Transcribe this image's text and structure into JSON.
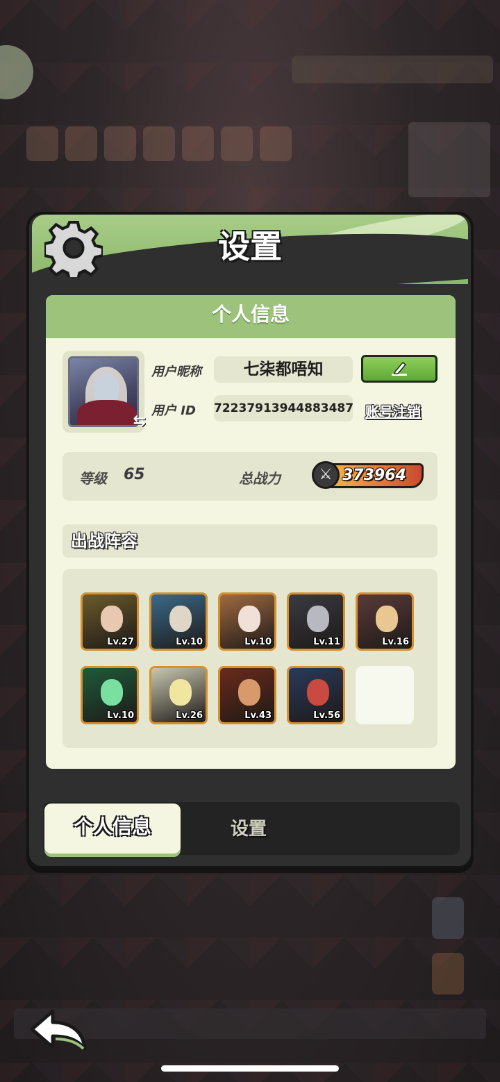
{
  "panel": {
    "title": "设置",
    "section_title": "个人信息"
  },
  "profile": {
    "nickname_label": "用户昵称",
    "nickname": "七柒都唔知",
    "id_label": "用户 ID",
    "user_id": "72237913944883487",
    "cancel_account_label": "账号注销",
    "swap_icon": "⇆"
  },
  "stats": {
    "level_label": "等级",
    "level": "65",
    "power_label": "总战力",
    "power": "373964"
  },
  "lineup": {
    "title": "出战阵容",
    "heroes": [
      {
        "lv": "Lv.27",
        "bg": "#6a5a2a",
        "skin": "#e8c8b0"
      },
      {
        "lv": "Lv.10",
        "bg": "#3a6a8a",
        "skin": "#e0d6c8"
      },
      {
        "lv": "Lv.10",
        "bg": "#a06a40",
        "skin": "#f0e0d8"
      },
      {
        "lv": "Lv.11",
        "bg": "#3a3a42",
        "skin": "#b8b8c0"
      },
      {
        "lv": "Lv.16",
        "bg": "#5a3a3a",
        "skin": "#e8c890"
      },
      {
        "lv": "Lv.10",
        "bg": "#1f5a3a",
        "skin": "#7ae0a0"
      },
      {
        "lv": "Lv.26",
        "bg": "#c8c8b0",
        "skin": "#f0e6a0"
      },
      {
        "lv": "Lv.43",
        "bg": "#6a2a1a",
        "skin": "#d89a6a"
      },
      {
        "lv": "Lv.56",
        "bg": "#2a3a5a",
        "skin": "#c84a40"
      }
    ]
  },
  "tabs": {
    "personal": "个人信息",
    "settings": "设置"
  }
}
